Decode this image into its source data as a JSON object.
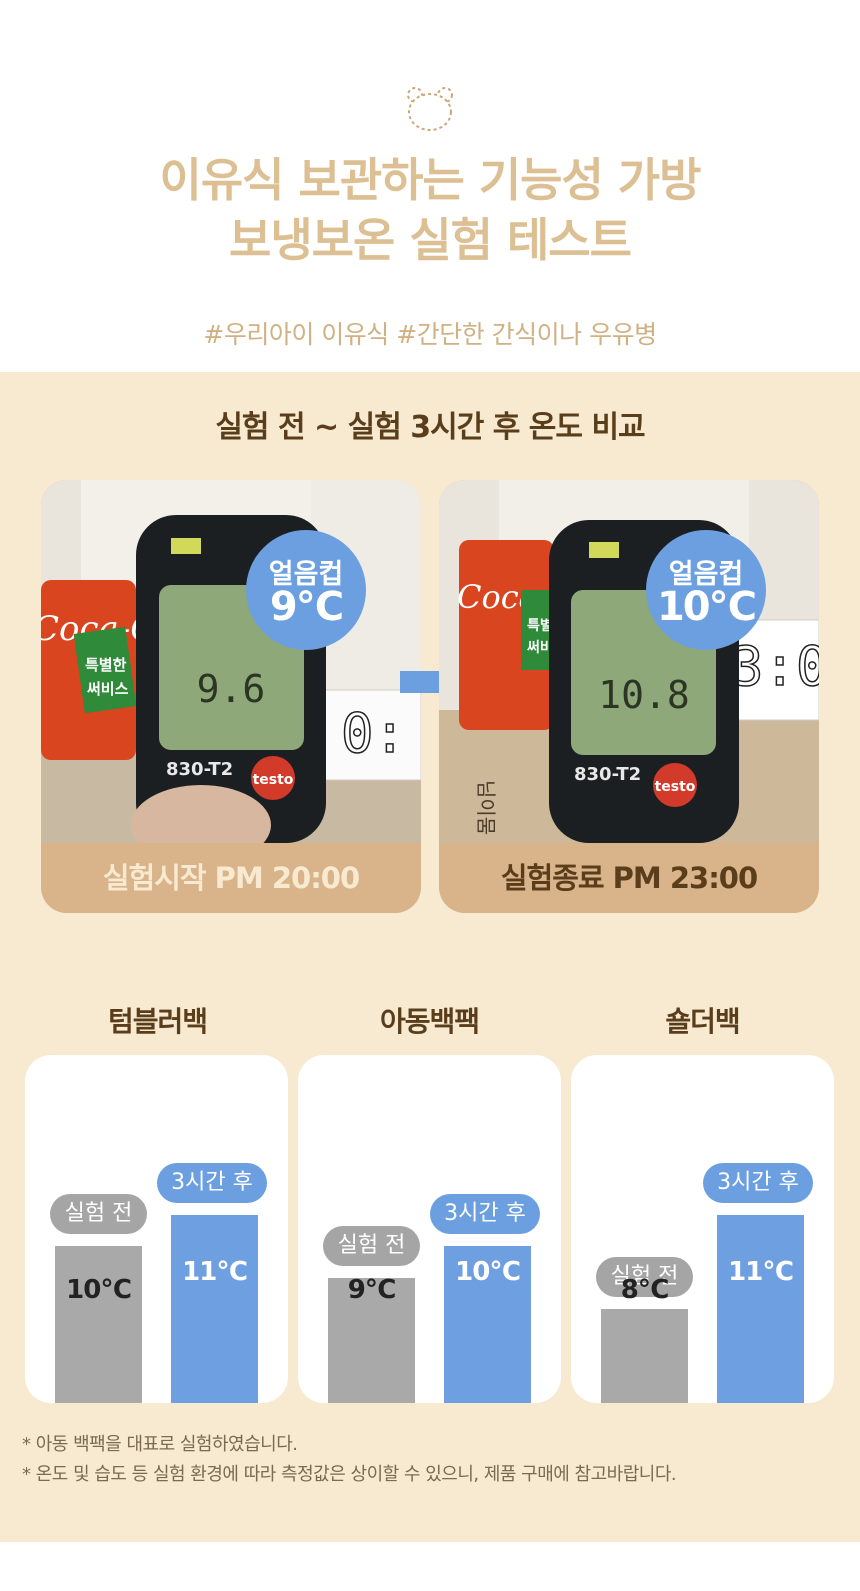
{
  "hero": {
    "bear_icon": "bear-outline-icon",
    "title_line1": "이유식 보관하는 기능성 가방",
    "title_line2": "보냉보온 실험 테스트",
    "tags": "#우리아이 이유식 #간단한 간식이나 우유병"
  },
  "compare": {
    "title": "실험 전 ~ 실험 3시간 후 온도 비교",
    "before": {
      "badge_label": "얼음컵",
      "badge_temp": "9℃",
      "caption": "실험시작 PM 20:00",
      "display_reading": "9.6",
      "meter_model": "830-T2",
      "meter_brand": "testo",
      "can_brand": "Coca-Cola",
      "can_sticker": "특별한 써비스"
    },
    "after": {
      "badge_label": "얼음컵",
      "badge_temp": "10℃",
      "caption": "실험종료 PM 23:00",
      "display_reading": "10.8",
      "meter_model": "830-T2",
      "meter_brand": "testo",
      "can_brand": "Coca-Cola",
      "can_sticker": "특별한 써비스"
    }
  },
  "colors": {
    "title": "#dcbf92",
    "band_bg": "#f7ead0",
    "accent_blue": "#6b9fe0",
    "grey": "#a9a9a9",
    "caption_bg": "#d9b38a"
  },
  "chart_data": {
    "type": "bar",
    "groups": [
      {
        "name": "텀블러백",
        "before_label": "실험 전",
        "after_label": "3시간 후",
        "before": 10,
        "after": 11,
        "before_text": "10℃",
        "after_text": "11℃"
      },
      {
        "name": "아동백팩",
        "before_label": "실험 전",
        "after_label": "3시간 후",
        "before": 9,
        "after": 10,
        "before_text": "9℃",
        "after_text": "10℃"
      },
      {
        "name": "숄더백",
        "before_label": "실험 전",
        "after_label": "3시간 후",
        "before": 8,
        "after": 11,
        "before_text": "8℃",
        "after_text": "11℃"
      }
    ]
  },
  "notes": {
    "line1": "* 아동 백팩을 대표로 실험하였습니다.",
    "line2": "* 온도 및 습도 등 실험 환경에 따라 측정값은 상이할 수 있으니, 제품 구매에 참고바랍니다."
  }
}
